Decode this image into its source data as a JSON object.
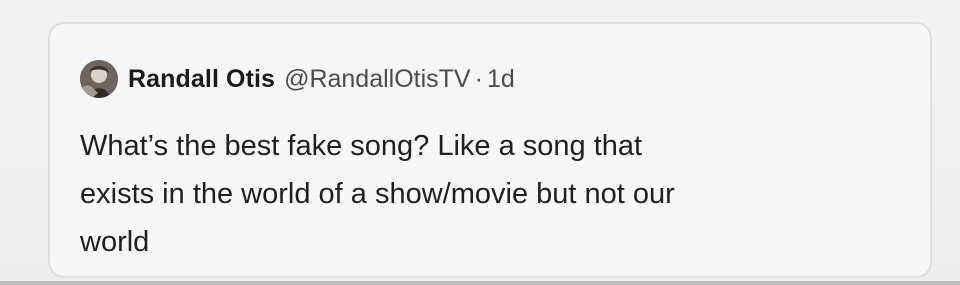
{
  "quoted_tweet": {
    "author": {
      "display_name": "Randall Otis",
      "handle": "@RandallOtisTV"
    },
    "separator": "·",
    "time": "1d",
    "text": "What’s the best fake song? Like a song that\nexists in the world of a show/movie but not our\nworld"
  },
  "icons": {
    "avatar": "profile-avatar"
  }
}
